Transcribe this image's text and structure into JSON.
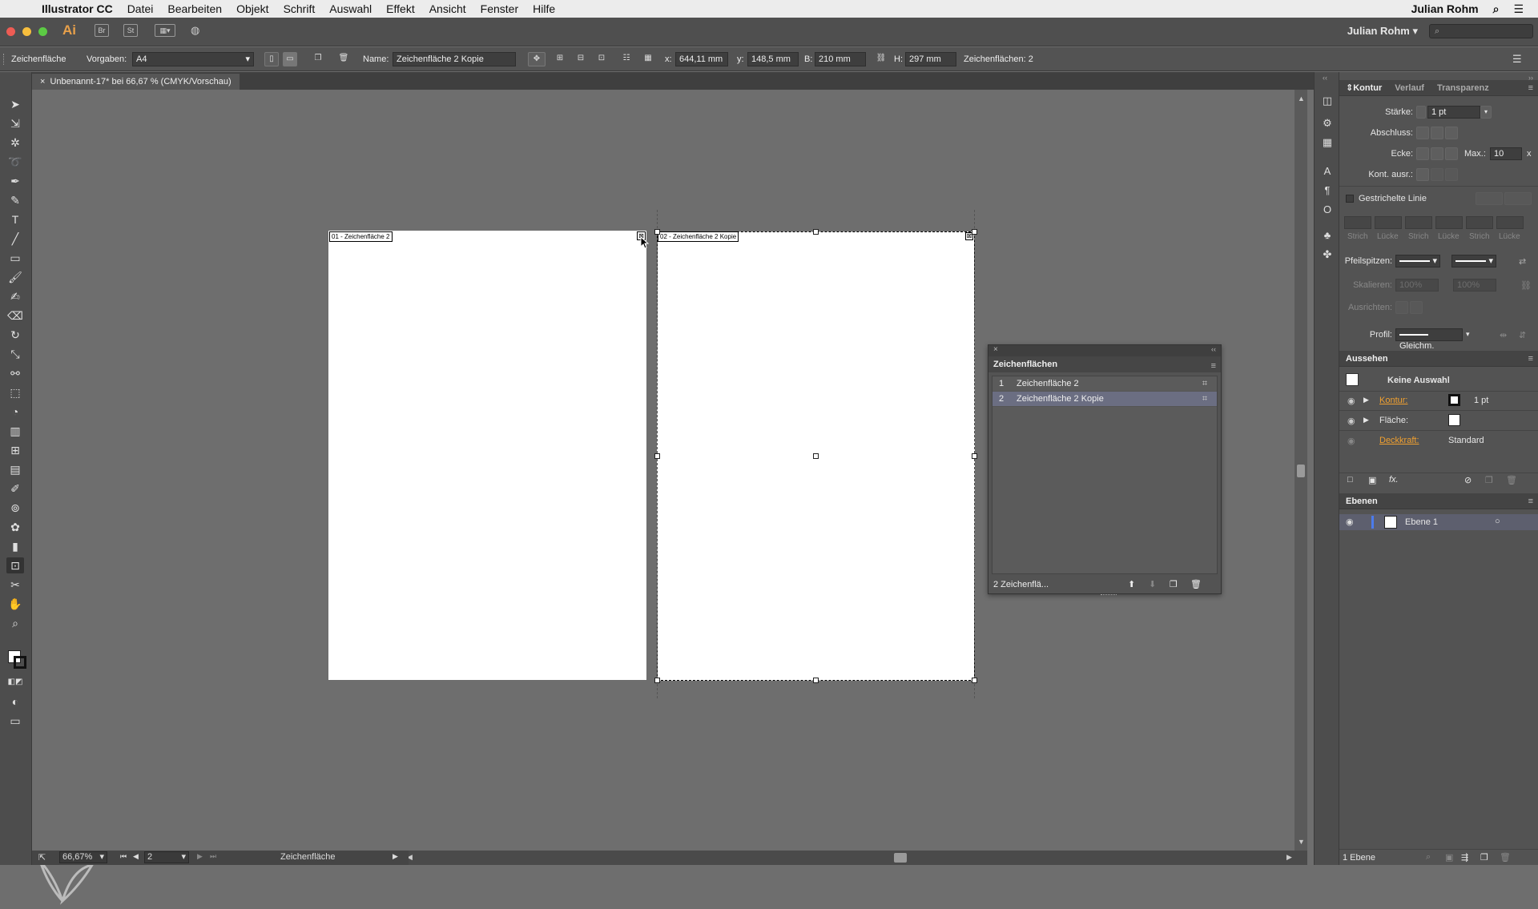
{
  "menubar": {
    "app_name": "Illustrator CC",
    "items": [
      "Datei",
      "Bearbeiten",
      "Objekt",
      "Schrift",
      "Auswahl",
      "Effekt",
      "Ansicht",
      "Fenster",
      "Hilfe"
    ],
    "user": "Julian Rohm"
  },
  "appbar": {
    "app_logo": "Ai",
    "bridge": "Br",
    "stock": "St",
    "user_menu": "Julian Rohm",
    "search_placeholder": ""
  },
  "controlbar": {
    "tool_name": "Zeichenfläche",
    "preset_label": "Vorgaben:",
    "preset_value": "A4",
    "name_label": "Name:",
    "name_value": "Zeichenfläche 2 Kopie",
    "x_label": "x:",
    "x_value": "644,11 mm",
    "y_label": "y:",
    "y_value": "148,5 mm",
    "w_label": "B:",
    "w_value": "210 mm",
    "h_label": "H:",
    "h_value": "297 mm",
    "count_label": "Zeichenflächen: 2"
  },
  "document": {
    "tab_title": "Unbenannt-17* bei 66,67 % (CMYK/Vorschau)",
    "artboard1_label": "01 - Zeichenfläche 2",
    "artboard2_label": "02 - Zeichenfläche 2 Kopie"
  },
  "kontur_panel": {
    "tabs": [
      "Kontur",
      "Verlauf",
      "Transparenz"
    ],
    "staerke_label": "Stärke:",
    "staerke_value": "1 pt",
    "abschluss_label": "Abschluss:",
    "ecke_label": "Ecke:",
    "max_label": "Max.:",
    "max_value": "10",
    "max_unit": "x",
    "kont_label": "Kont. ausr.:",
    "dashed_label": "Gestrichelte Linie",
    "dash_labels": [
      "Strich",
      "Lücke",
      "Strich",
      "Lücke",
      "Strich",
      "Lücke"
    ],
    "pfeil_label": "Pfeilspitzen:",
    "skalieren_label": "Skalieren:",
    "skal_value1": "100%",
    "skal_value2": "100%",
    "ausrichten_label": "Ausrichten:",
    "profil_label": "Profil:",
    "profil_value": "Gleichm."
  },
  "aussehen_panel": {
    "title": "Aussehen",
    "selection": "Keine Auswahl",
    "kontur_label": "Kontur:",
    "kontur_value": "1 pt",
    "flaeche_label": "Fläche:",
    "deckkraft_label": "Deckkraft:",
    "deckkraft_value": "Standard"
  },
  "ebenen_panel": {
    "title": "Ebenen",
    "layer": "Ebene 1",
    "footer": "1 Ebene"
  },
  "artboards_panel": {
    "title": "Zeichenflächen",
    "rows": [
      {
        "num": "1",
        "name": "Zeichenfläche 2"
      },
      {
        "num": "2",
        "name": "Zeichenfläche 2 Kopie"
      }
    ],
    "footer": "2 Zeichenflä..."
  },
  "statusbar": {
    "zoom": "66,67%",
    "page": "2",
    "tool": "Zeichenfläche"
  },
  "colors": {
    "canvas": "#6e6e6e",
    "panel": "#535353",
    "selected_row": "#6b6e82",
    "accent_link": "#f0a030"
  }
}
